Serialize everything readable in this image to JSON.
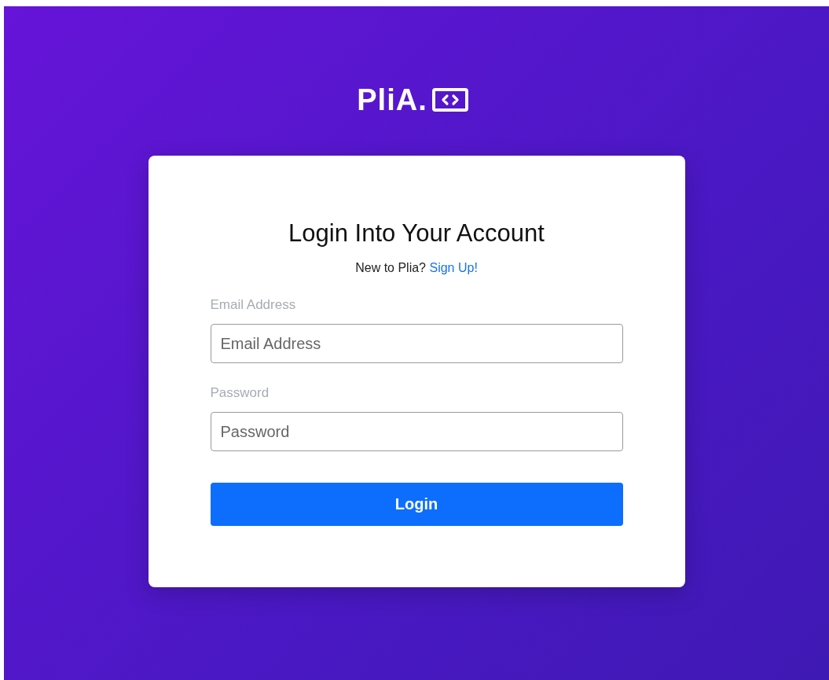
{
  "logo": {
    "text": "PliA."
  },
  "card": {
    "title": "Login Into Your Account",
    "prompt": "New to Plia?",
    "link": "Sign Up!"
  },
  "fields": [
    {
      "label": "Email Address",
      "placeholder": "Email Address"
    },
    {
      "label": "Password",
      "placeholder": "Password"
    }
  ],
  "button": "Login"
}
